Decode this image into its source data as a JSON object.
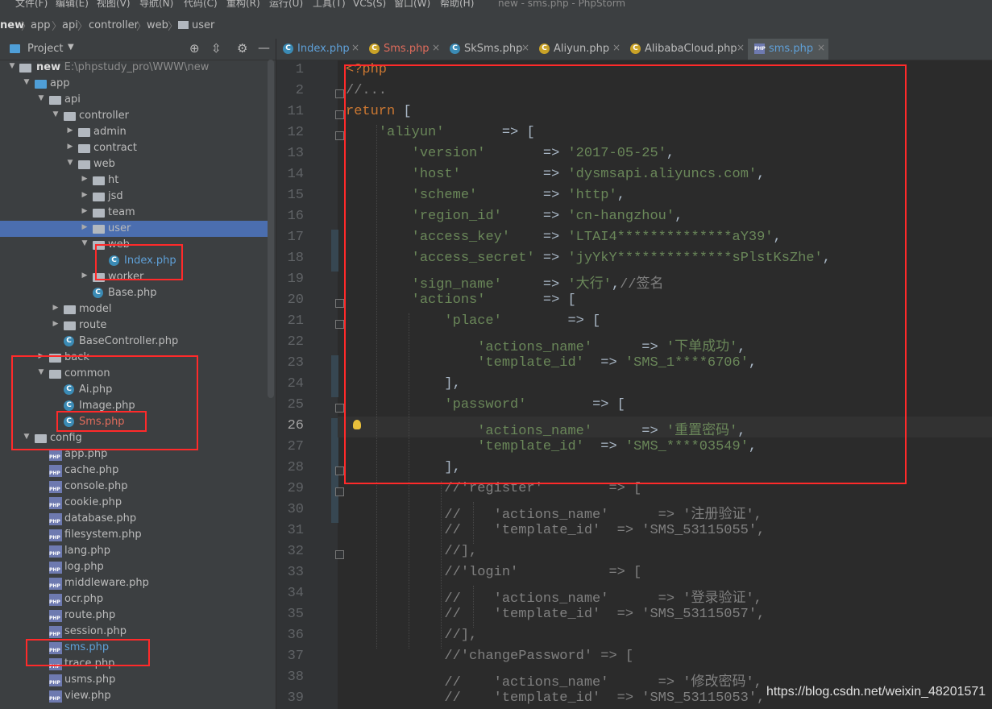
{
  "menu": {
    "items": [
      "文件(F)",
      "编辑(E)",
      "视图(V)",
      "导航(N)",
      "代码(C)",
      "重构(R)",
      "运行(U)",
      "工具(T)",
      "VCS(S)",
      "窗口(W)",
      "帮助(H)"
    ],
    "window_title": "new - sms.php - PhpStorm"
  },
  "breadcrumb": [
    "new",
    "app",
    "api",
    "controller",
    "web",
    "user"
  ],
  "project_panel": {
    "title": "Project",
    "root_name": "new",
    "root_path": "E:\\phpstudy_pro\\WWW\\new",
    "tree": [
      {
        "label": "app",
        "kind": "folder-blue",
        "arrow": "down",
        "depth": 1
      },
      {
        "label": "api",
        "kind": "folder",
        "arrow": "down",
        "depth": 2
      },
      {
        "label": "controller",
        "kind": "folder",
        "arrow": "down",
        "depth": 3
      },
      {
        "label": "admin",
        "kind": "folder",
        "arrow": "right",
        "depth": 4
      },
      {
        "label": "contract",
        "kind": "folder",
        "arrow": "right",
        "depth": 4
      },
      {
        "label": "web",
        "kind": "folder",
        "arrow": "down",
        "depth": 4
      },
      {
        "label": "ht",
        "kind": "folder",
        "arrow": "right",
        "depth": 5
      },
      {
        "label": "jsd",
        "kind": "folder",
        "arrow": "right",
        "depth": 5
      },
      {
        "label": "team",
        "kind": "folder",
        "arrow": "right",
        "depth": 5
      },
      {
        "label": "user",
        "kind": "folder",
        "arrow": "right",
        "depth": 5,
        "selected": true
      },
      {
        "label": "web",
        "kind": "folder",
        "arrow": "down",
        "depth": 5
      },
      {
        "label": "Index.php",
        "kind": "class",
        "depth": 6,
        "color": "blue"
      },
      {
        "label": "worker",
        "kind": "folder",
        "arrow": "right",
        "depth": 5
      },
      {
        "label": "Base.php",
        "kind": "class",
        "depth": 5
      },
      {
        "label": "model",
        "kind": "folder",
        "arrow": "right",
        "depth": 3
      },
      {
        "label": "route",
        "kind": "folder",
        "arrow": "right",
        "depth": 3
      },
      {
        "label": "BaseController.php",
        "kind": "class",
        "depth": 3
      },
      {
        "label": "back",
        "kind": "folder",
        "arrow": "right",
        "depth": 2
      },
      {
        "label": "common",
        "kind": "folder",
        "arrow": "down",
        "depth": 2
      },
      {
        "label": "Ai.php",
        "kind": "class",
        "depth": 3
      },
      {
        "label": "Image.php",
        "kind": "class",
        "depth": 3
      },
      {
        "label": "Sms.php",
        "kind": "class",
        "depth": 3,
        "color": "red"
      },
      {
        "label": "config",
        "kind": "folder",
        "arrow": "down",
        "depth": 1
      },
      {
        "label": "app.php",
        "kind": "php",
        "depth": 2
      },
      {
        "label": "cache.php",
        "kind": "php",
        "depth": 2
      },
      {
        "label": "console.php",
        "kind": "php",
        "depth": 2
      },
      {
        "label": "cookie.php",
        "kind": "php",
        "depth": 2
      },
      {
        "label": "database.php",
        "kind": "php",
        "depth": 2
      },
      {
        "label": "filesystem.php",
        "kind": "php",
        "depth": 2
      },
      {
        "label": "lang.php",
        "kind": "php",
        "depth": 2
      },
      {
        "label": "log.php",
        "kind": "php",
        "depth": 2
      },
      {
        "label": "middleware.php",
        "kind": "php",
        "depth": 2
      },
      {
        "label": "ocr.php",
        "kind": "php",
        "depth": 2
      },
      {
        "label": "route.php",
        "kind": "php",
        "depth": 2
      },
      {
        "label": "session.php",
        "kind": "php",
        "depth": 2
      },
      {
        "label": "sms.php",
        "kind": "php",
        "depth": 2,
        "color": "blue"
      },
      {
        "label": "trace.php",
        "kind": "php",
        "depth": 2
      },
      {
        "label": "usms.php",
        "kind": "php",
        "depth": 2
      },
      {
        "label": "view.php",
        "kind": "php",
        "depth": 2
      }
    ]
  },
  "tabs": [
    {
      "label": "Index.php",
      "icon": "class",
      "color": "#5fa0d8"
    },
    {
      "label": "Sms.php",
      "icon": "class-warn",
      "color": "#e06c5c"
    },
    {
      "label": "SkSms.php",
      "icon": "class",
      "color": "#bbbbbb"
    },
    {
      "label": "Aliyun.php",
      "icon": "class-warn",
      "color": "#bbbbbb"
    },
    {
      "label": "AlibabaCloud.php",
      "icon": "class-warn",
      "color": "#bbbbbb"
    },
    {
      "label": "sms.php",
      "icon": "php",
      "color": "#5fa0d8",
      "active": true
    }
  ],
  "editor": {
    "current_line": "26",
    "lines": [
      {
        "n": "1",
        "t": [
          [
            "kw",
            "<?php"
          ]
        ]
      },
      {
        "n": "2",
        "t": [
          [
            "cm",
            "//..."
          ]
        ]
      },
      {
        "n": "11",
        "t": [
          [
            "kw",
            "return"
          ],
          [
            "op",
            " ["
          ]
        ]
      },
      {
        "n": "12",
        "t": [
          [
            "op",
            "    "
          ],
          [
            "str",
            "'aliyun'"
          ],
          [
            "op",
            "       => ["
          ]
        ]
      },
      {
        "n": "13",
        "t": [
          [
            "op",
            "        "
          ],
          [
            "str",
            "'version'"
          ],
          [
            "op",
            "       => "
          ],
          [
            "str",
            "'2017-05-25'"
          ],
          [
            "op",
            ","
          ]
        ]
      },
      {
        "n": "14",
        "t": [
          [
            "op",
            "        "
          ],
          [
            "str",
            "'host'"
          ],
          [
            "op",
            "          => "
          ],
          [
            "str",
            "'dysmsapi.aliyuncs.com'"
          ],
          [
            "op",
            ","
          ]
        ]
      },
      {
        "n": "15",
        "t": [
          [
            "op",
            "        "
          ],
          [
            "str",
            "'scheme'"
          ],
          [
            "op",
            "        => "
          ],
          [
            "str",
            "'http'"
          ],
          [
            "op",
            ","
          ]
        ]
      },
      {
        "n": "16",
        "t": [
          [
            "op",
            "        "
          ],
          [
            "str",
            "'region_id'"
          ],
          [
            "op",
            "     => "
          ],
          [
            "str",
            "'cn-hangzhou'"
          ],
          [
            "op",
            ","
          ]
        ]
      },
      {
        "n": "17",
        "t": [
          [
            "op",
            "        "
          ],
          [
            "str",
            "'access_key'"
          ],
          [
            "op",
            "    => "
          ],
          [
            "str",
            "'LTAI4**************aY39'"
          ],
          [
            "op",
            ","
          ]
        ]
      },
      {
        "n": "18",
        "t": [
          [
            "op",
            "        "
          ],
          [
            "str",
            "'access_secret'"
          ],
          [
            "op",
            " => "
          ],
          [
            "str",
            "'jyYkY**************sPlstKsZhe'"
          ],
          [
            "op",
            ","
          ]
        ]
      },
      {
        "n": "19",
        "t": [
          [
            "op",
            "        "
          ],
          [
            "str",
            "'sign_name'"
          ],
          [
            "op",
            "     => "
          ],
          [
            "str",
            "'大行'"
          ],
          [
            "op",
            ","
          ],
          [
            "cm",
            "//签名"
          ]
        ]
      },
      {
        "n": "20",
        "t": [
          [
            "op",
            "        "
          ],
          [
            "str",
            "'actions'"
          ],
          [
            "op",
            "       => ["
          ]
        ]
      },
      {
        "n": "21",
        "t": [
          [
            "op",
            "            "
          ],
          [
            "str",
            "'place'"
          ],
          [
            "op",
            "        => ["
          ]
        ]
      },
      {
        "n": "22",
        "t": [
          [
            "op",
            "                "
          ],
          [
            "str",
            "'actions_name'"
          ],
          [
            "op",
            "      => "
          ],
          [
            "str",
            "'下单成功'"
          ],
          [
            "op",
            ","
          ]
        ]
      },
      {
        "n": "23",
        "t": [
          [
            "op",
            "                "
          ],
          [
            "str",
            "'template_id'"
          ],
          [
            "op",
            "  => "
          ],
          [
            "str",
            "'SMS_1****6706'"
          ],
          [
            "op",
            ","
          ]
        ]
      },
      {
        "n": "24",
        "t": [
          [
            "op",
            "            ],"
          ]
        ]
      },
      {
        "n": "25",
        "t": [
          [
            "op",
            "            "
          ],
          [
            "str",
            "'password'"
          ],
          [
            "op",
            "        => ["
          ]
        ]
      },
      {
        "n": "26",
        "t": [
          [
            "op",
            "                "
          ],
          [
            "str",
            "'actions_name'"
          ],
          [
            "op",
            "      => "
          ],
          [
            "str",
            "'重置密码'"
          ],
          [
            "op",
            ","
          ]
        ]
      },
      {
        "n": "27",
        "t": [
          [
            "op",
            "                "
          ],
          [
            "str",
            "'template_id'"
          ],
          [
            "op",
            "  => "
          ],
          [
            "str",
            "'SMS_****03549'"
          ],
          [
            "op",
            ","
          ]
        ]
      },
      {
        "n": "28",
        "t": [
          [
            "op",
            "            ],"
          ]
        ]
      },
      {
        "n": "29",
        "t": [
          [
            "op",
            "            "
          ],
          [
            "cm",
            "//'register'        => ["
          ]
        ]
      },
      {
        "n": "30",
        "t": [
          [
            "op",
            "            "
          ],
          [
            "cm",
            "//    'actions_name'      => '注册验证',"
          ]
        ]
      },
      {
        "n": "31",
        "t": [
          [
            "op",
            "            "
          ],
          [
            "cm",
            "//    'template_id'  => 'SMS_53115055',"
          ]
        ]
      },
      {
        "n": "32",
        "t": [
          [
            "op",
            "            "
          ],
          [
            "cm",
            "//],"
          ]
        ]
      },
      {
        "n": "33",
        "t": [
          [
            "op",
            "            "
          ],
          [
            "cm",
            "//'login'           => ["
          ]
        ]
      },
      {
        "n": "34",
        "t": [
          [
            "op",
            "            "
          ],
          [
            "cm",
            "//    'actions_name'      => '登录验证',"
          ]
        ]
      },
      {
        "n": "35",
        "t": [
          [
            "op",
            "            "
          ],
          [
            "cm",
            "//    'template_id'  => 'SMS_53115057',"
          ]
        ]
      },
      {
        "n": "36",
        "t": [
          [
            "op",
            "            "
          ],
          [
            "cm",
            "//],"
          ]
        ]
      },
      {
        "n": "37",
        "t": [
          [
            "op",
            "            "
          ],
          [
            "cm",
            "//'changePassword' => ["
          ]
        ]
      },
      {
        "n": "38",
        "t": [
          [
            "op",
            "            "
          ],
          [
            "cm",
            "//    'actions_name'      => '修改密码',"
          ]
        ]
      },
      {
        "n": "39",
        "t": [
          [
            "op",
            "            "
          ],
          [
            "cm",
            "//    'template_id'  => 'SMS_53115053',"
          ]
        ]
      }
    ]
  },
  "watermark": "https://blog.csdn.net/weixin_48201571",
  "colors": {
    "selection": "#4b6eaf",
    "annotation_red": "#ff2a2a",
    "keyword": "#cc7832",
    "string": "#6a8759",
    "comment": "#808080"
  }
}
